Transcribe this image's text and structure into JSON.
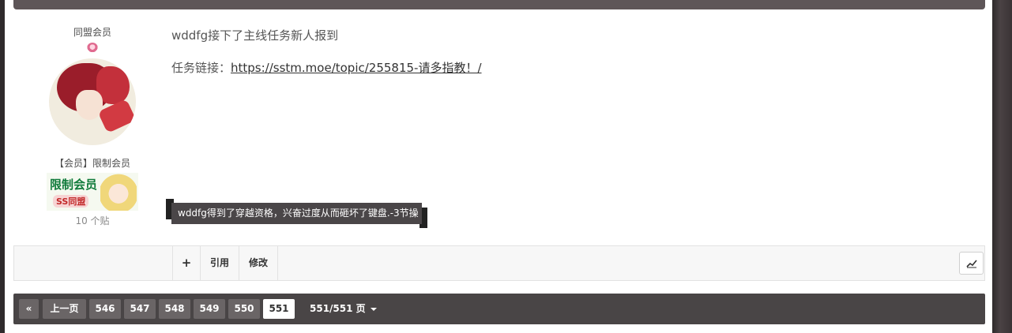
{
  "author": {
    "group": "同盟会员",
    "group_icon": "member-badge-icon",
    "rank": "【会员】限制会员",
    "rank_badge_text": "限制会员",
    "rank_badge_sub": "SS同盟",
    "post_count": "10 个贴"
  },
  "post": {
    "title": "wddfg接下了主线任务新人报到",
    "link_prefix": "任务链接：",
    "link_text": "https://sstm.moe/topic/255815-请多指教！/"
  },
  "notice": {
    "text": "wddfg得到了穿越资格，兴奋过度从而砸坏了键盘.-3节操"
  },
  "toolbar": {
    "plus_label": "+",
    "quote_label": "引用",
    "edit_label": "修改",
    "chart_icon": "activity-chart-icon"
  },
  "pager": {
    "first_label": "«",
    "prev_label": "上一页",
    "pages": [
      "546",
      "547",
      "548",
      "549",
      "550",
      "551"
    ],
    "active_page": "551",
    "jump_label": "551/551 页"
  },
  "colors": {
    "pager_bg": "#494546",
    "page_button": "#6a6566",
    "active_page": "#ffffff"
  }
}
